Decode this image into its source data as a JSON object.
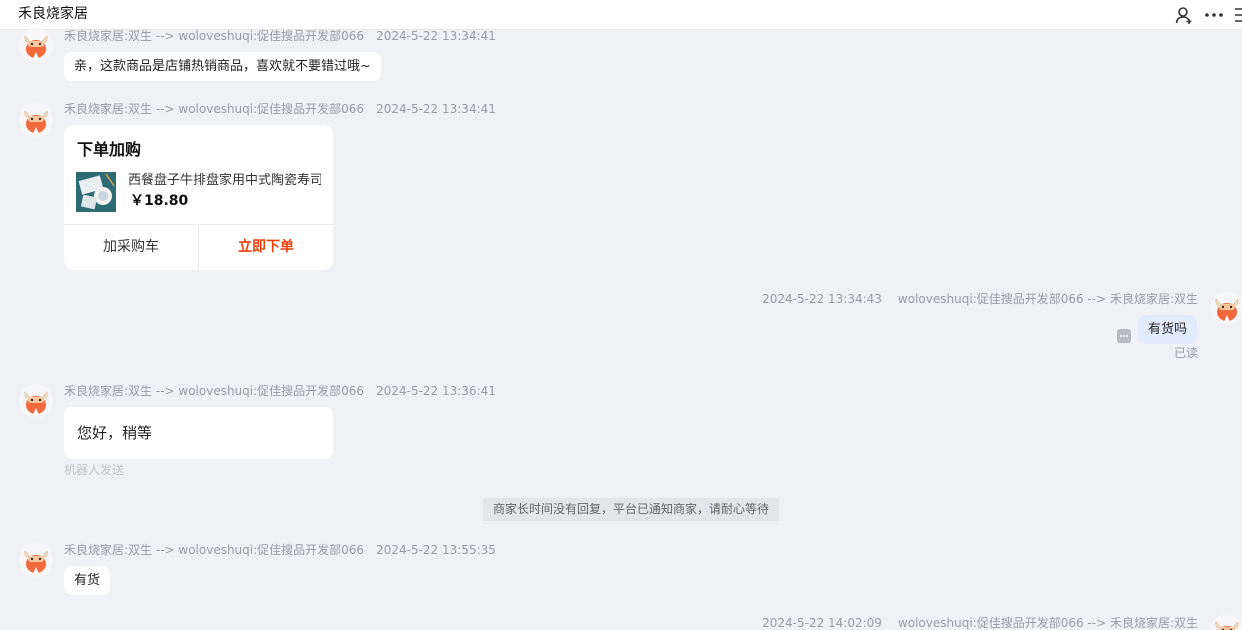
{
  "header": {
    "title": "禾良烧家居"
  },
  "messages": [
    {
      "sender_line": "禾良烧家居:双生 --> woloveshuqi:促佳搜品开发部066",
      "time": "2024-5-22 13:34:41",
      "text": "亲，这款商品是店铺热销商品，喜欢就不要错过哦~"
    },
    {
      "sender_line": "禾良烧家居:双生 --> woloveshuqi:促佳搜品开发部066",
      "time": "2024-5-22 13:34:41",
      "card": {
        "title": "下单加购",
        "product_name": "西餐盘子牛排盘家用中式陶瓷寿司",
        "price": "￥18.80",
        "cart_label": "加采购车",
        "order_label": "立即下单"
      }
    },
    {
      "sender_line": "woloveshuqi:促佳搜品开发部066 --> 禾良烧家居:双生",
      "time": "2024-5-22 13:34:43",
      "text": "有货吗",
      "status": "已读"
    },
    {
      "sender_line": "禾良烧家居:双生 --> woloveshuqi:促佳搜品开发部066",
      "time": "2024-5-22 13:36:41",
      "text": "您好，稍等",
      "note": "机器人发送"
    },
    {
      "sender_line": "禾良烧家居:双生 --> woloveshuqi:促佳搜品开发部066",
      "time": "2024-5-22 13:55:35",
      "text": "有货"
    },
    {
      "sender_line": "woloveshuqi:促佳搜品开发部066 --> 禾良烧家居:双生",
      "time": "2024-5-22 14:02:09"
    }
  ],
  "system_notice": "商家长时间没有回复，平台已通知商家，请耐心等待",
  "colors": {
    "background": "#f0f1f5",
    "my_bubble": "#e3ecfd",
    "order_accent": "#f0410d",
    "avatar": "#f26a3c"
  }
}
